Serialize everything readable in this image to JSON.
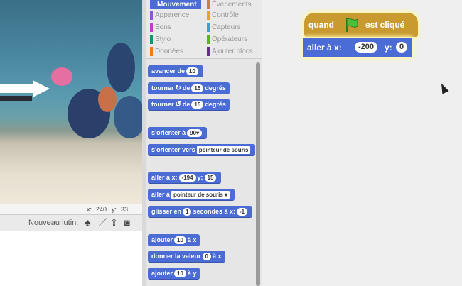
{
  "stage": {
    "x_label": "x:",
    "x_value": "240",
    "y_label": "y:",
    "y_value": "33"
  },
  "sprite_bar": {
    "new_sprite_label": "Nouveau lutin:"
  },
  "categories": [
    {
      "label": "Mouvement",
      "color": "#4a6cd4",
      "active": true
    },
    {
      "label": "Apparence",
      "color": "#8a55d7"
    },
    {
      "label": "Sons",
      "color": "#bb42c3"
    },
    {
      "label": "Stylo",
      "color": "#0e9a6c"
    },
    {
      "label": "Données",
      "color": "#ee7d16"
    },
    {
      "label": "Événements",
      "color": "#c88330"
    },
    {
      "label": "Contrôle",
      "color": "#e1a91a"
    },
    {
      "label": "Capteurs",
      "color": "#2ca5e2"
    },
    {
      "label": "Opérateurs",
      "color": "#5cb712"
    },
    {
      "label": "Ajouter blocs",
      "color": "#632d99"
    }
  ],
  "palette": {
    "move": {
      "a": "avancer de",
      "v": "10"
    },
    "turn_right": {
      "a": "tourner",
      "b": "de",
      "v": "15",
      "c": "degrés"
    },
    "turn_left": {
      "a": "tourner",
      "b": "de",
      "v": "15",
      "c": "degrés"
    },
    "point_dir": {
      "a": "s'orienter à",
      "v": "90▾"
    },
    "point_towards": {
      "a": "s'orienter vers",
      "v": "pointeur de souris"
    },
    "goto_xy": {
      "a": "aller à x:",
      "x": "-194",
      "b": "y:",
      "y": "15"
    },
    "goto_target": {
      "a": "aller à",
      "v": "pointeur de souris ▾"
    },
    "glide": {
      "a": "glisser en",
      "v": "1",
      "b": "secondes à x:",
      "x": "-1"
    },
    "change_x": {
      "a": "ajouter",
      "v": "10",
      "b": "à x"
    },
    "set_x": {
      "a": "donner la valeur",
      "v": "0",
      "b": "à x"
    },
    "change_y": {
      "a": "ajouter",
      "v": "10",
      "b": "à y"
    }
  },
  "script": {
    "hat_when": "quand",
    "hat_clicked": "est cliqué",
    "goto_a": "aller à x:",
    "goto_x": "-200",
    "goto_b": "y:",
    "goto_y": "0"
  }
}
